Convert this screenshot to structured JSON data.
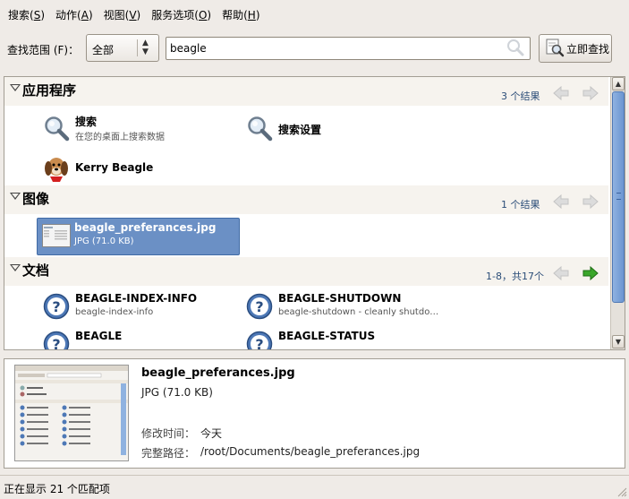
{
  "menu": [
    {
      "label": "搜索",
      "key": "S"
    },
    {
      "label": "动作",
      "key": "A"
    },
    {
      "label": "视图",
      "key": "V"
    },
    {
      "label": "服务选项",
      "key": "O"
    },
    {
      "label": "帮助",
      "key": "H"
    }
  ],
  "search": {
    "scope_label": "查找范围 (F)：",
    "scope_value": "全部",
    "query": "beagle",
    "find_button": "立即查找"
  },
  "categories": [
    {
      "title": "应用程序",
      "count": "3 个结果",
      "hits": [
        {
          "title": "搜索",
          "subtitle": "在您的桌面上搜索数据",
          "icon": "magnifier-icon"
        },
        {
          "title": "搜索设置",
          "subtitle": "",
          "icon": "magnifier-icon"
        },
        {
          "title": "Kerry Beagle",
          "subtitle": "",
          "icon": "beagle-dog-icon"
        }
      ]
    },
    {
      "title": "图像",
      "count": "1 个结果",
      "hits": [
        {
          "title": "beagle_preferances.jpg",
          "subtitle": "JPG (71.0 KB)",
          "icon": "image-thumbnail-icon"
        }
      ]
    },
    {
      "title": "文档",
      "count": "1-8，共17个",
      "hits": [
        {
          "title": "BEAGLE-INDEX-INFO",
          "subtitle": "beagle-index-info",
          "icon": "help-document-icon"
        },
        {
          "title": "BEAGLE-SHUTDOWN",
          "subtitle": "beagle-shutdown - cleanly shutdo…",
          "icon": "help-document-icon"
        },
        {
          "title": "BEAGLE",
          "subtitle": "",
          "icon": "help-document-icon"
        },
        {
          "title": "BEAGLE-STATUS",
          "subtitle": "",
          "icon": "help-document-icon"
        }
      ]
    }
  ],
  "preview": {
    "title": "beagle_preferances.jpg",
    "subtitle": "JPG (71.0 KB)",
    "modified_label": "修改时间：",
    "modified_value": "今天",
    "path_label": "完整路径：",
    "path_value": "/root/Documents/beagle_preferances.jpg"
  },
  "status": "正在显示 21 个匹配项",
  "colors": {
    "selection": "#6b90c5",
    "count_text": "#2b4d78",
    "next_arrow_active": "#3aa62a"
  }
}
